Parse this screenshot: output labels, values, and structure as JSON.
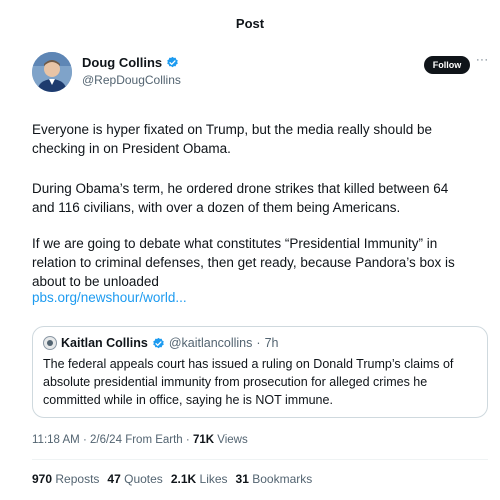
{
  "header": {
    "title": "Post"
  },
  "author": {
    "name": "Doug Collins",
    "handle": "@RepDougCollins",
    "verified_color": "#1d9bf0"
  },
  "actions": {
    "follow_label": "Follow",
    "more_icon": "more-horizontal-icon"
  },
  "post": {
    "paragraphs": [
      "Everyone is hyper fixated on Trump, but the media really should be checking in on President Obama.",
      "During Obama’s term, he ordered drone strikes that killed between 64 and 116 civilians, with over a dozen of them being Americans.",
      "If we are going to debate what constitutes “Presidential Immunity” in relation to criminal defenses, then get ready, because Pandora’s box is about to be unloaded"
    ],
    "link": "pbs.org/newshour/world..."
  },
  "quote": {
    "name": "Kaitlan Collins",
    "handle": "@kaitlancollins",
    "separator": "·",
    "time": "7h",
    "text": "The federal appeals court has issued a ruling on Donald Trump’s claims of absolute presidential immunity from prosecution for alleged crimes he committed while in office, saying he is NOT immune."
  },
  "meta": {
    "time": "11:18 AM",
    "date": "2/6/24",
    "source": "From Earth",
    "separator": "·",
    "views_count": "71K",
    "views_label": "Views"
  },
  "stats": {
    "reposts_count": "970",
    "reposts_label": "Reposts",
    "quotes_count": "47",
    "quotes_label": "Quotes",
    "likes_count": "2.1K",
    "likes_label": "Likes",
    "bookmarks_count": "31",
    "bookmarks_label": "Bookmarks"
  },
  "colors": {
    "accent": "#1d9bf0",
    "text": "#0f1419",
    "secondary": "#536471",
    "border": "#cfd9de"
  }
}
